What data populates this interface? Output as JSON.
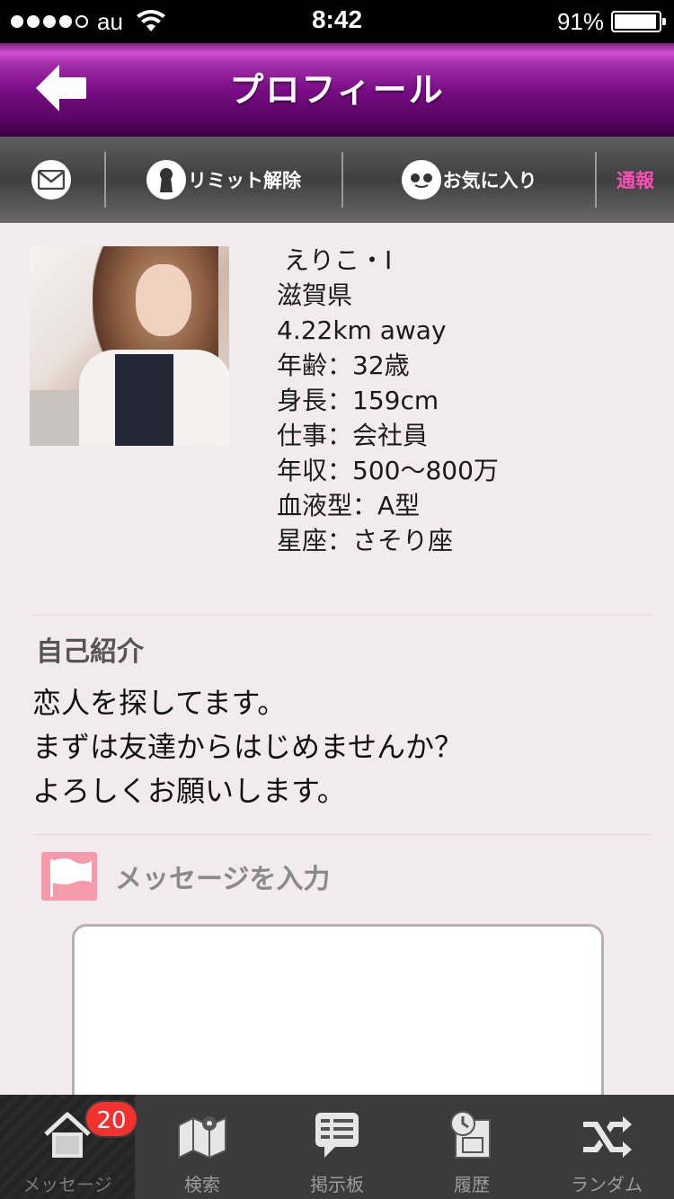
{
  "status_bar": {
    "carrier": "au",
    "time": "8:42",
    "battery": "91%",
    "signal_bars": 4,
    "battery_level": 0.91
  },
  "header": {
    "title": "プロフィール"
  },
  "actions": {
    "limit_label": "リミット解除",
    "favorite_label": "お気に入り",
    "report_label": "通報"
  },
  "profile": {
    "name": "えりこ・I",
    "prefecture": "滋賀県",
    "distance": "4.22km away",
    "age": "年齢：32歳",
    "height": "身長：159cm",
    "job": "仕事：会社員",
    "income": "年収：500～800万",
    "blood_type": "血液型：A型",
    "zodiac": "星座：さそり座"
  },
  "intro": {
    "title": "自己紹介",
    "text": " 恋人を探してます。\nまずは友達からはじめませんか？\nよろしくお願いします。"
  },
  "message": {
    "label": "メッセージを入力",
    "value": ""
  },
  "tabs": [
    {
      "label": "メッセージ",
      "icon": "house-icon",
      "badge": "20",
      "active": true
    },
    {
      "label": "検索",
      "icon": "map-icon"
    },
    {
      "label": "掲示板",
      "icon": "board-icon"
    },
    {
      "label": "履歴",
      "icon": "history-icon"
    },
    {
      "label": "ランダム",
      "icon": "random-icon"
    }
  ],
  "colors": {
    "header_purple": "#7a0d86",
    "report_pink": "#ff4fb8",
    "badge_red": "#f3312f",
    "background": "#f3eaee"
  }
}
